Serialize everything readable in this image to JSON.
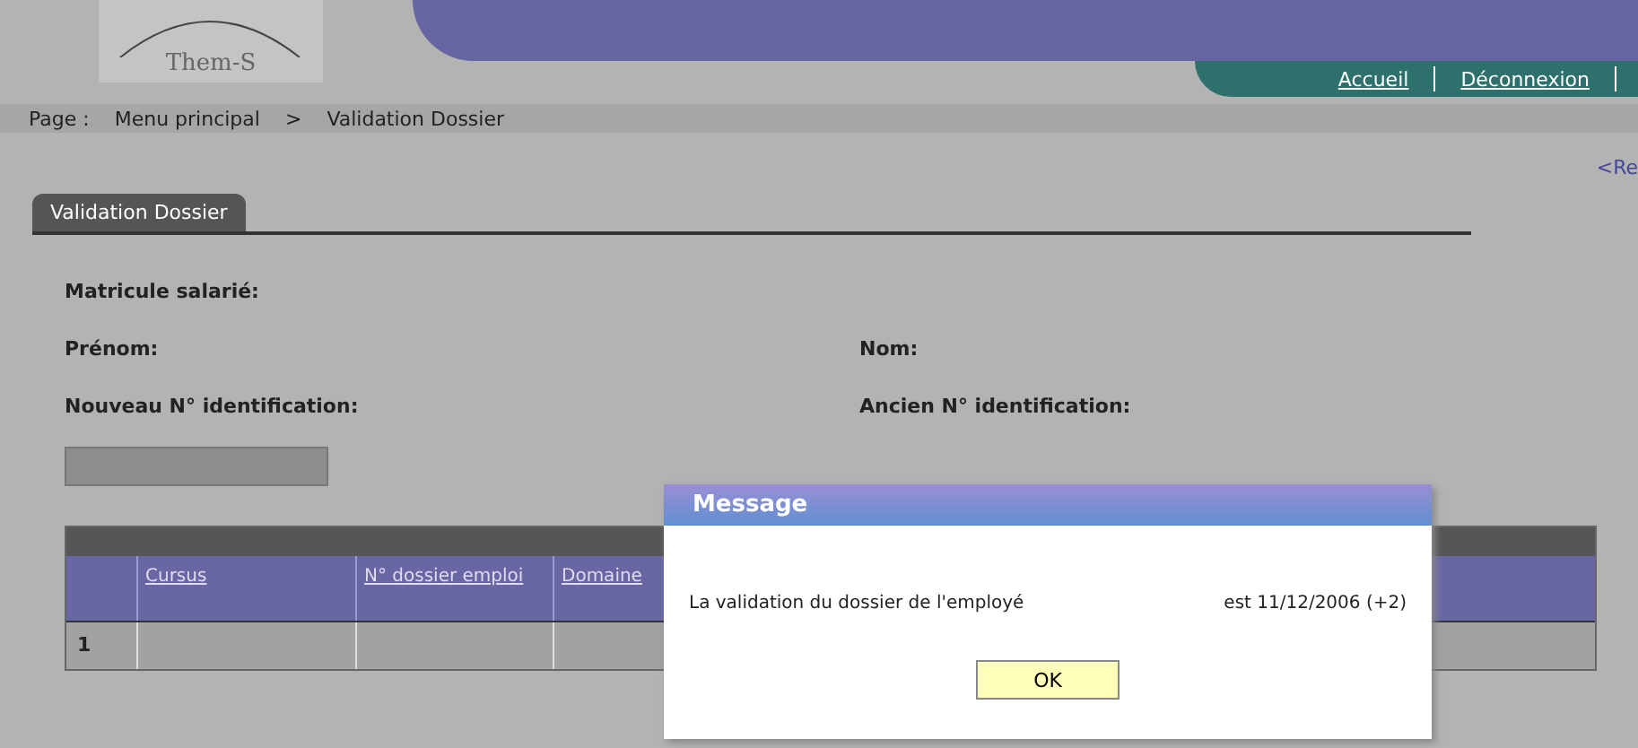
{
  "header": {
    "logo": "Them-S",
    "links": [
      {
        "label": "Accueil"
      },
      {
        "label": "Déconnexion"
      }
    ]
  },
  "breadcrumb": [
    "Page :",
    "Menu principal",
    ">",
    "Validation Dossier"
  ],
  "back_link": "<Re",
  "tabs": [
    {
      "label": "Validation Dossier",
      "selected": true
    }
  ],
  "field_rows": [
    [
      {
        "label": "Matricule salarié:"
      }
    ],
    [
      {
        "label": "Prénom:"
      },
      {
        "label": "Nom:"
      }
    ],
    [
      {
        "label": "Nouveau N° identification:"
      },
      {
        "label": "Ancien N° identification:"
      }
    ]
  ],
  "table": {
    "columns": [
      "",
      "Cursus",
      "N° dossier emploi",
      "Domaine"
    ],
    "rows": [
      [
        "1",
        "",
        "",
        ""
      ]
    ]
  },
  "dialog": {
    "title": "Message",
    "message": "La validation du dossier de l'employé",
    "message_end": "est 11/12/2006 (+2)",
    "button": "OK"
  }
}
